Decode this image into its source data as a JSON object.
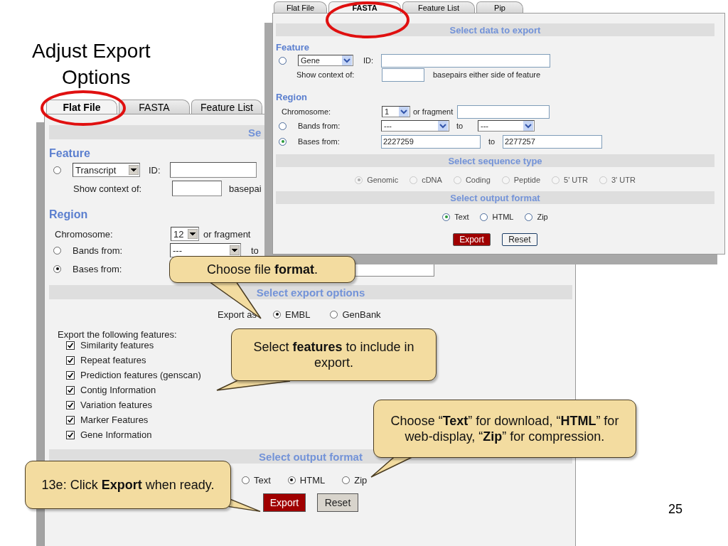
{
  "slide": {
    "title": "Adjust Export Options",
    "page_number": "25"
  },
  "back_window": {
    "tabs": [
      {
        "label": "Flat File",
        "selected": true
      },
      {
        "label": "FASTA",
        "selected": false
      },
      {
        "label": "Feature List",
        "selected": false
      }
    ],
    "blocks": [
      {
        "kind": "header",
        "text": "Se"
      },
      {
        "kind": "heading",
        "text": "Feature"
      },
      {
        "kind": "row",
        "items": [
          {
            "kind": "radio",
            "selected": false,
            "disabled": false
          },
          {
            "kind": "select",
            "value": "Transcript"
          },
          {
            "kind": "label",
            "text": "ID:"
          },
          {
            "kind": "input"
          }
        ]
      },
      {
        "kind": "row",
        "items": [
          {
            "kind": "label",
            "text": "Show context of:"
          },
          {
            "kind": "input"
          },
          {
            "kind": "label",
            "text": "basepai"
          }
        ]
      },
      {
        "kind": "heading",
        "text": "Region"
      },
      {
        "kind": "row",
        "items": [
          {
            "kind": "label",
            "text": "Chromosome:"
          },
          {
            "kind": "select",
            "value": "12"
          },
          {
            "kind": "label",
            "text": "or fragment"
          }
        ]
      },
      {
        "kind": "row",
        "items": [
          {
            "kind": "radio",
            "selected": false,
            "disabled": false
          },
          {
            "kind": "label",
            "text": "Bands from:"
          },
          {
            "kind": "select",
            "value": "---"
          },
          {
            "kind": "label",
            "text": "to"
          }
        ]
      },
      {
        "kind": "row",
        "items": [
          {
            "kind": "radio",
            "selected": true,
            "disabled": false
          },
          {
            "kind": "label",
            "text": "Bases from:"
          },
          {
            "kind": "input"
          }
        ]
      },
      {
        "kind": "header",
        "text": "Select export options"
      },
      {
        "kind": "row",
        "items": [
          {
            "kind": "label",
            "text": "Export as"
          },
          {
            "kind": "radio",
            "label": "EMBL",
            "selected": true,
            "disabled": false
          },
          {
            "kind": "radio",
            "label": "GenBank",
            "selected": false,
            "disabled": false
          }
        ]
      },
      {
        "kind": "text",
        "text": "Export the following features:"
      },
      {
        "kind": "checkbox",
        "label": "Similarity features",
        "checked": true
      },
      {
        "kind": "checkbox",
        "label": "Repeat features",
        "checked": true
      },
      {
        "kind": "checkbox",
        "label": "Prediction features (genscan)",
        "checked": true
      },
      {
        "kind": "checkbox",
        "label": "Contig Information",
        "checked": true
      },
      {
        "kind": "checkbox",
        "label": "Variation features",
        "checked": true
      },
      {
        "kind": "checkbox",
        "label": "Marker Features",
        "checked": true
      },
      {
        "kind": "checkbox",
        "label": "Gene Information",
        "checked": true
      },
      {
        "kind": "header",
        "text": "Select output format"
      },
      {
        "kind": "row",
        "items": [
          {
            "kind": "radio",
            "label": "Text",
            "selected": false,
            "disabled": false
          },
          {
            "kind": "radio",
            "label": "HTML",
            "selected": true,
            "disabled": false
          },
          {
            "kind": "radio",
            "label": "Zip",
            "selected": false,
            "disabled": false
          }
        ]
      },
      {
        "kind": "row",
        "items": [
          {
            "kind": "button",
            "label": "Export",
            "primary": true
          },
          {
            "kind": "button",
            "label": "Reset",
            "primary": false
          }
        ]
      }
    ]
  },
  "front_window": {
    "tabs": [
      {
        "label": "Flat File",
        "selected": false
      },
      {
        "label": "FASTA",
        "selected": true
      },
      {
        "label": "Feature List",
        "selected": false
      },
      {
        "label": "Pip",
        "selected": false
      }
    ],
    "blocks": [
      {
        "kind": "header",
        "text": "Select data to export"
      },
      {
        "kind": "heading",
        "text": "Feature"
      },
      {
        "kind": "row",
        "items": [
          {
            "kind": "radio",
            "selected": false,
            "disabled": false
          },
          {
            "kind": "select",
            "value": "Gene"
          },
          {
            "kind": "label",
            "text": "ID:"
          },
          {
            "kind": "input"
          }
        ]
      },
      {
        "kind": "row",
        "items": [
          {
            "kind": "label",
            "text": "Show context of:"
          },
          {
            "kind": "input"
          },
          {
            "kind": "label",
            "text": "basepairs either side of feature"
          }
        ]
      },
      {
        "kind": "heading",
        "text": "Region"
      },
      {
        "kind": "row",
        "items": [
          {
            "kind": "label",
            "text": "Chromosome:"
          },
          {
            "kind": "select",
            "value": "1"
          },
          {
            "kind": "label",
            "text": "or fragment"
          },
          {
            "kind": "input"
          }
        ]
      },
      {
        "kind": "row",
        "items": [
          {
            "kind": "radio",
            "selected": false,
            "disabled": false
          },
          {
            "kind": "label",
            "text": "Bands from:"
          },
          {
            "kind": "select",
            "value": "---"
          },
          {
            "kind": "label",
            "text": "to"
          },
          {
            "kind": "select",
            "value": "---"
          }
        ]
      },
      {
        "kind": "row",
        "items": [
          {
            "kind": "radio",
            "selected": true,
            "disabled": false
          },
          {
            "kind": "label",
            "text": "Bases from:"
          },
          {
            "kind": "input",
            "value": "2227259"
          },
          {
            "kind": "label",
            "text": "to"
          },
          {
            "kind": "input",
            "value": "2277257"
          }
        ]
      },
      {
        "kind": "header",
        "text": "Select sequence type"
      },
      {
        "kind": "row",
        "items": [
          {
            "kind": "radio",
            "label": "Genomic",
            "selected": true,
            "disabled": true
          },
          {
            "kind": "radio",
            "label": "cDNA",
            "selected": false,
            "disabled": true
          },
          {
            "kind": "radio",
            "label": "Coding",
            "selected": false,
            "disabled": true
          },
          {
            "kind": "radio",
            "label": "Peptide",
            "selected": false,
            "disabled": true
          },
          {
            "kind": "radio",
            "label": "5' UTR",
            "selected": false,
            "disabled": true
          },
          {
            "kind": "radio",
            "label": "3' UTR",
            "selected": false,
            "disabled": true
          }
        ]
      },
      {
        "kind": "header",
        "text": "Select output format"
      },
      {
        "kind": "row",
        "items": [
          {
            "kind": "radio",
            "label": "Text",
            "selected": true,
            "disabled": false
          },
          {
            "kind": "radio",
            "label": "HTML",
            "selected": false,
            "disabled": false
          },
          {
            "kind": "radio",
            "label": "Zip",
            "selected": false,
            "disabled": false
          }
        ]
      },
      {
        "kind": "row",
        "items": [
          {
            "kind": "button",
            "label": "Export",
            "primary": true
          },
          {
            "kind": "button",
            "label": "Reset",
            "primary": false
          }
        ]
      }
    ]
  },
  "callouts": [
    {
      "text": "Choose file **format**."
    },
    {
      "text": "Select **features** to include in export."
    },
    {
      "text": "Choose “**Text**” for download, “**HTML**” for web-display, “**Zip**” for compression."
    },
    {
      "text": "13e: Click **Export** when ready."
    }
  ]
}
